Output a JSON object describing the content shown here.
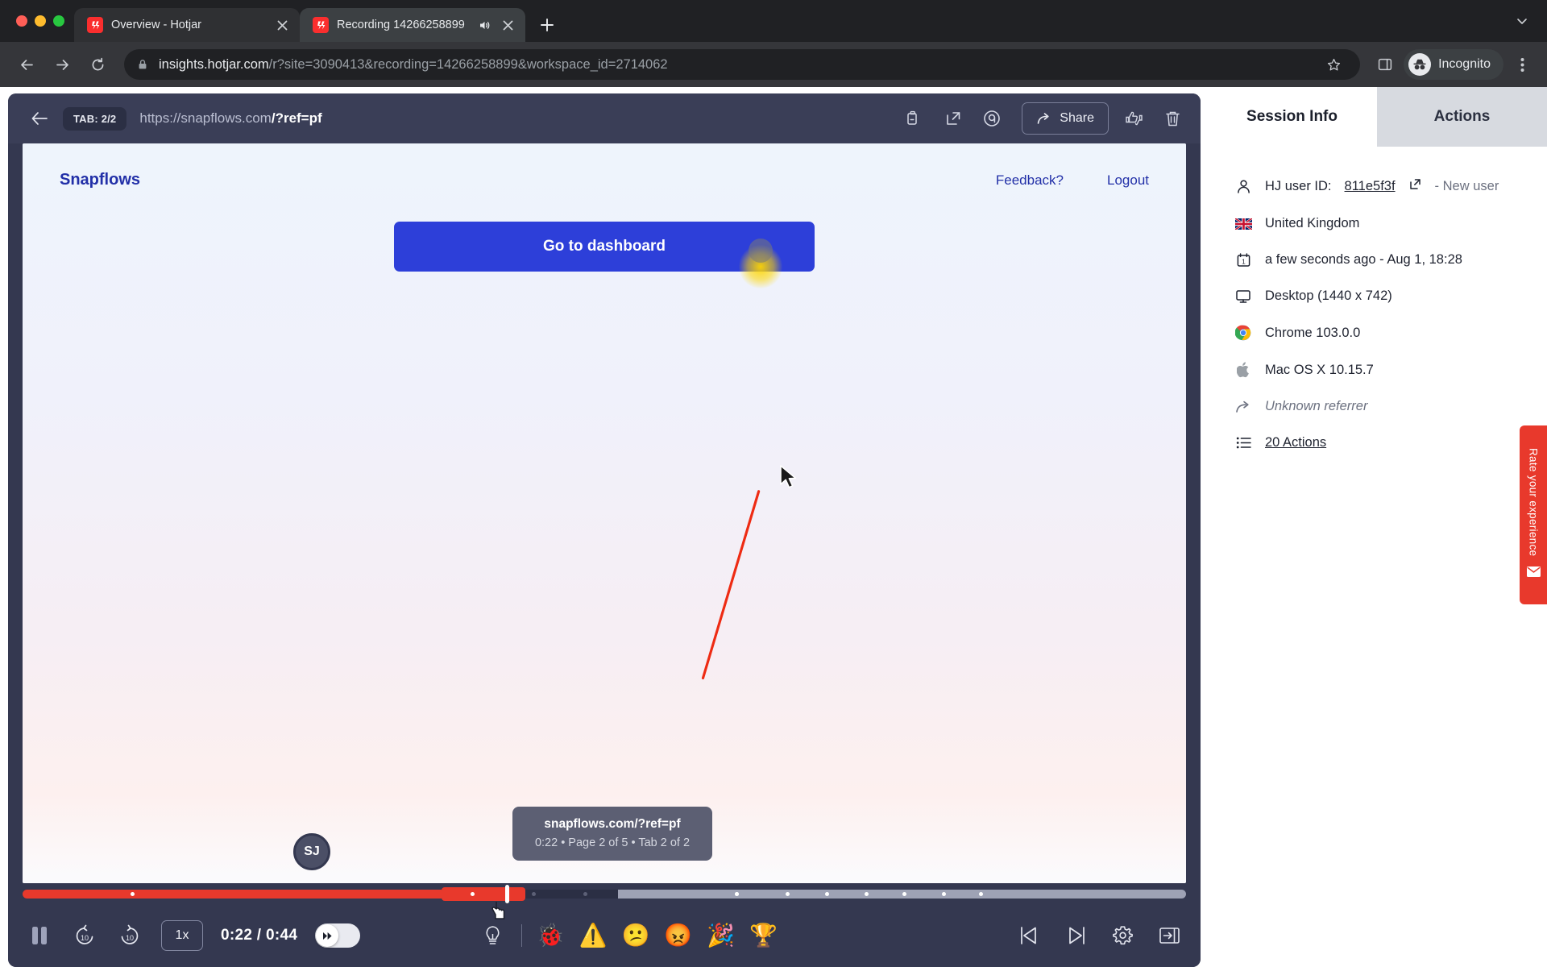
{
  "browser": {
    "tabs": [
      {
        "title": "Overview - Hotjar",
        "favicon": "hotjar-favicon",
        "active": false,
        "audio": false
      },
      {
        "title": "Recording 14266258899",
        "favicon": "hotjar-favicon",
        "active": true,
        "audio": true
      }
    ],
    "new_tab_label": "+",
    "address": {
      "host": "insights.hotjar.com",
      "path": "/r?site=3090413&recording=14266258899&workspace_id=2714062"
    },
    "profile_label": "Incognito"
  },
  "player": {
    "tab_badge": "TAB: 2/2",
    "url_prefix": "https://snapflows.com",
    "url_suffix": "/?ref=pf",
    "share_label": "Share",
    "header_icons": [
      "copy-icon",
      "open-external-icon",
      "highlight-icon"
    ],
    "tooltip": {
      "url": "snapflows.com/?ref=pf",
      "meta": "0:22 • Page 2 of 5 • Tab 2 of 2"
    },
    "avatar_initials": "SJ",
    "controls": {
      "play_state": "pause",
      "rewind_label": "10",
      "forward_label": "10",
      "speed": "1x",
      "timecode": "0:22 / 0:44",
      "skip_inactivity": true,
      "reactions": [
        {
          "name": "lightbulb-icon",
          "glyph": "💡"
        },
        {
          "name": "bug-icon",
          "glyph": "🐞"
        },
        {
          "name": "warning-icon",
          "glyph": "⚠️"
        },
        {
          "name": "confused-face-icon",
          "glyph": "😕"
        },
        {
          "name": "angry-face-icon",
          "glyph": "😡"
        },
        {
          "name": "party-popper-icon",
          "glyph": "🎉"
        },
        {
          "name": "trophy-icon",
          "glyph": "🏆"
        }
      ],
      "right_icons": [
        "previous-recording-icon",
        "next-recording-icon",
        "settings-icon",
        "collapse-panel-icon"
      ]
    },
    "timeline": {
      "current_time": "0:22",
      "total_time": "0:44",
      "progress_percent": 50
    }
  },
  "site": {
    "brand": "Snapflows",
    "nav_links": [
      "Feedback?",
      "Logout"
    ],
    "cta_label": "Go to dashboard"
  },
  "sidebar": {
    "tabs": [
      {
        "label": "Session Info",
        "active": true
      },
      {
        "label": "Actions",
        "active": false
      }
    ],
    "info": {
      "user_prefix": "HJ user ID:",
      "user_id": "811e5f3f",
      "user_suffix": "- New user",
      "country": "United Kingdom",
      "time": "a few seconds ago - Aug 1, 18:28",
      "device": "Desktop (1440 x 742)",
      "browser": "Chrome 103.0.0",
      "os": "Mac OS X 10.15.7",
      "referrer": "Unknown referrer",
      "actions": "20 Actions"
    },
    "rate_tab": "Rate your experience"
  },
  "colors": {
    "hotjar_red": "#e8392c",
    "player_bg": "#343850",
    "player_header": "#3a3e57",
    "cta_blue": "#2d3fd9",
    "brand_blue": "#2230a8"
  }
}
